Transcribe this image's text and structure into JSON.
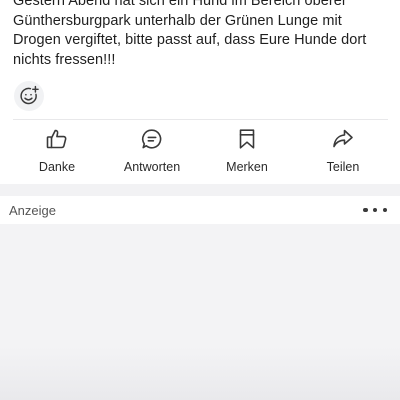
{
  "post": {
    "text": "Gestern Abend hat sich ein Hund im Bereich oberer Günthersburgpark unterhalb der Grünen Lunge mit Drogen vergiftet, bitte passt auf, dass Eure Hunde dort nichts fressen!!!",
    "reaction_icon": "add-reaction-icon"
  },
  "actions": [
    {
      "label": "Danke",
      "icon": "thumbs-up-icon"
    },
    {
      "label": "Antworten",
      "icon": "speech-bubble-icon"
    },
    {
      "label": "Merken",
      "icon": "bookmark-icon"
    },
    {
      "label": "Teilen",
      "icon": "share-arrow-icon"
    }
  ],
  "ad": {
    "label": "Anzeige",
    "menu_icon": "more-dots-icon"
  },
  "colors": {
    "icon": "#3a3a3a",
    "text": "#1f1f1f",
    "divider": "#e8e8ea",
    "ad_background": "#f3f3f5"
  }
}
